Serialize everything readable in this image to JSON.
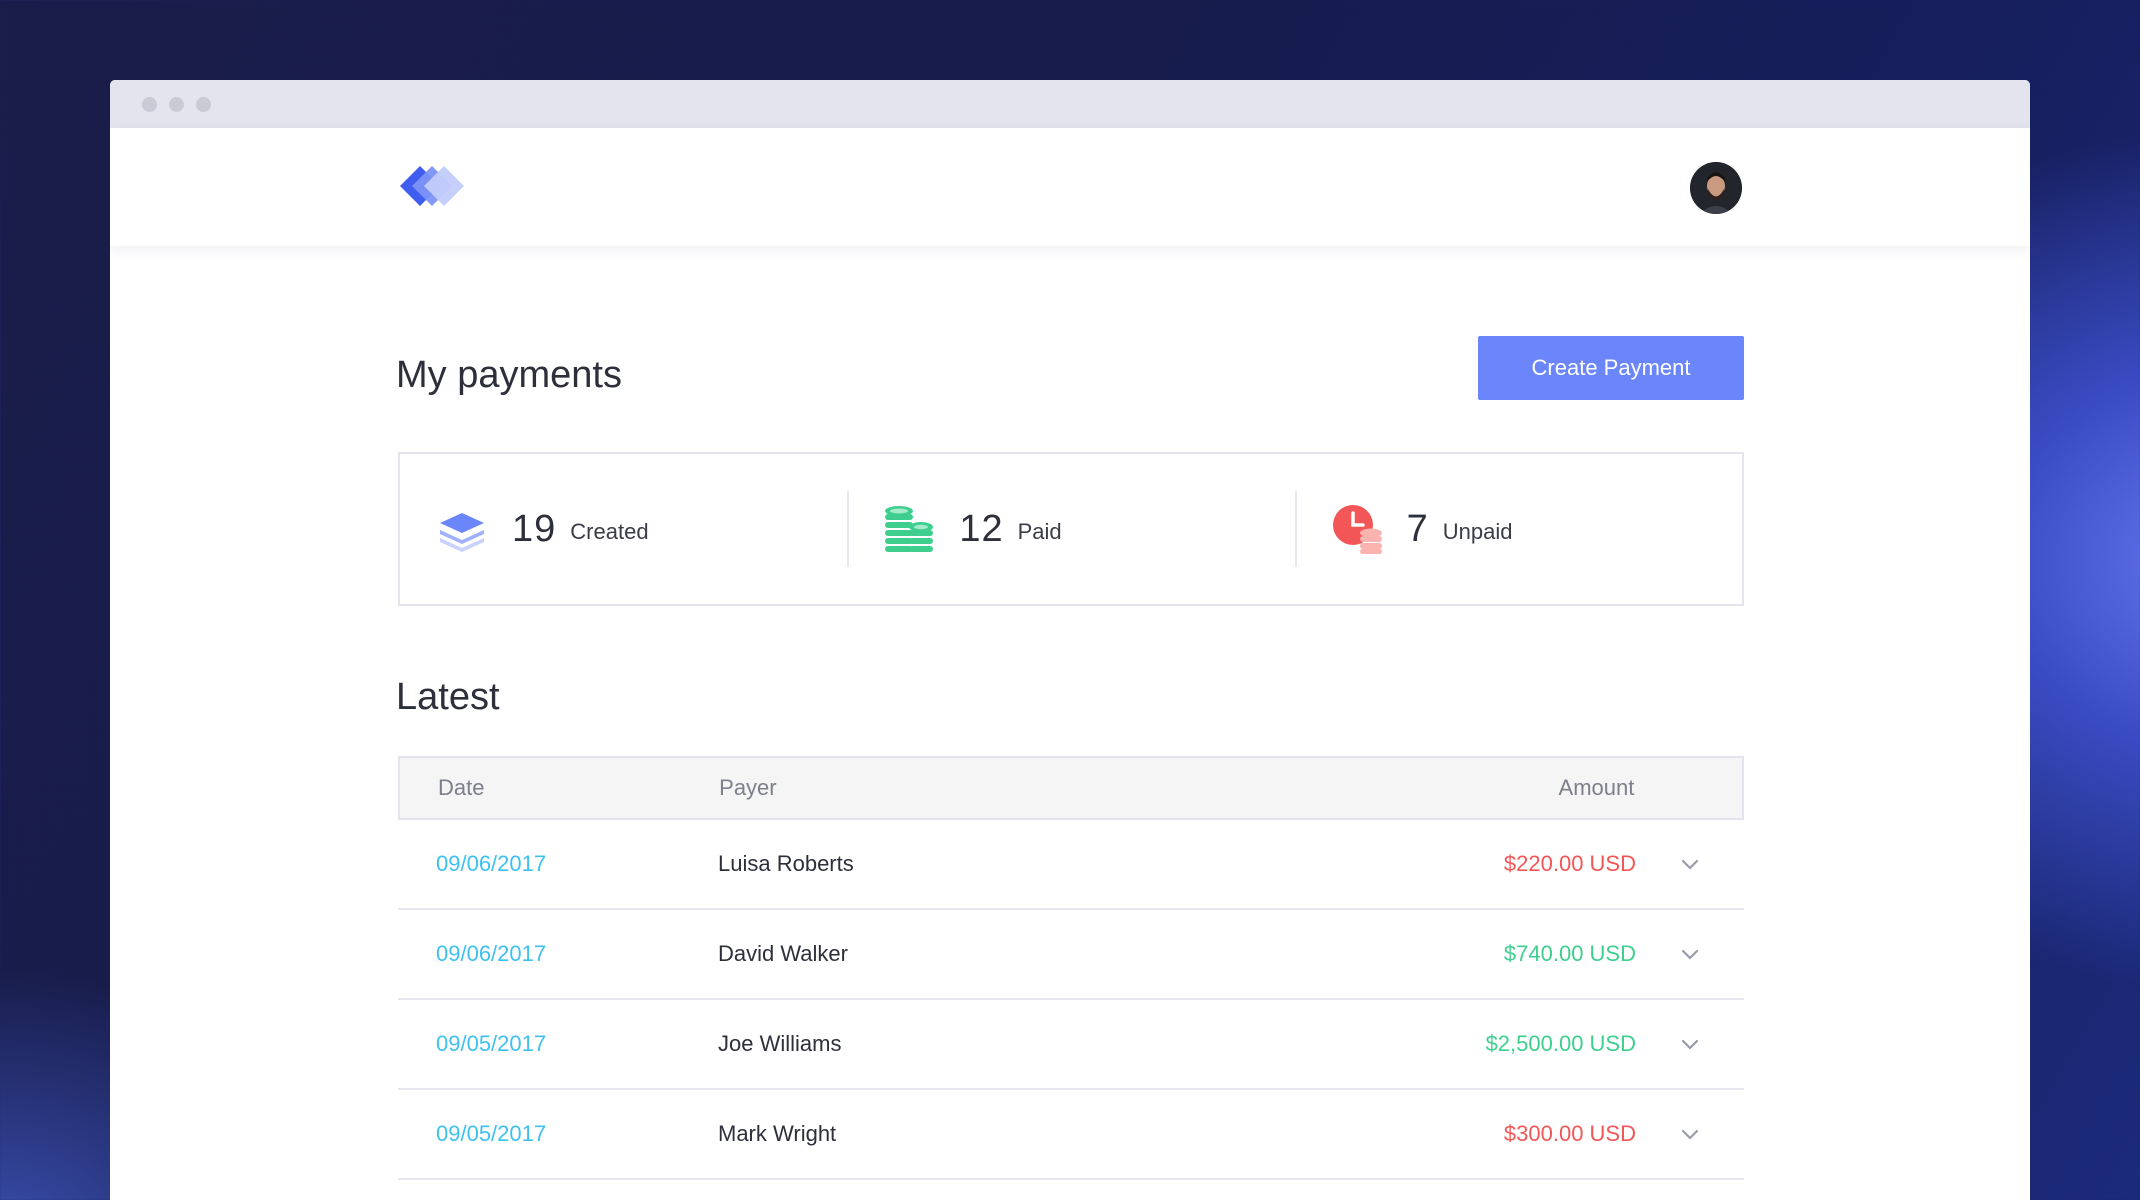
{
  "page": {
    "heading": "My payments",
    "create_button": "Create Payment",
    "latest_heading": "Latest"
  },
  "stats": [
    {
      "value": "19",
      "label": "Created",
      "icon": "layers-icon",
      "color": "#6b85fb"
    },
    {
      "value": "12",
      "label": "Paid",
      "icon": "coins-icon",
      "color": "#3ecf8e"
    },
    {
      "value": "7",
      "label": "Unpaid",
      "icon": "clock-coins-icon",
      "color": "#f25656"
    }
  ],
  "table": {
    "headers": {
      "date": "Date",
      "payer": "Payer",
      "amount": "Amount"
    },
    "rows": [
      {
        "date": "09/06/2017",
        "payer": "Luisa Roberts",
        "amount": "$220.00 USD",
        "status": "unpaid"
      },
      {
        "date": "09/06/2017",
        "payer": "David Walker",
        "amount": "$740.00 USD",
        "status": "paid"
      },
      {
        "date": "09/05/2017",
        "payer": "Joe Williams",
        "amount": "$2,500.00 USD",
        "status": "paid"
      },
      {
        "date": "09/05/2017",
        "payer": "Mark Wright",
        "amount": "$300.00 USD",
        "status": "unpaid"
      }
    ]
  },
  "colors": {
    "accent": "#6b85fb",
    "paid": "#3ecf8e",
    "unpaid": "#f25656",
    "date": "#3ec1f0"
  }
}
